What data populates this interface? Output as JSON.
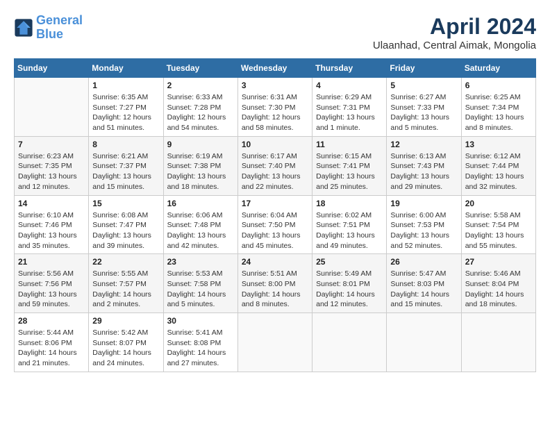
{
  "logo": {
    "line1": "General",
    "line2": "Blue"
  },
  "title": "April 2024",
  "location": "Ulaanhad, Central Aimak, Mongolia",
  "weekdays": [
    "Sunday",
    "Monday",
    "Tuesday",
    "Wednesday",
    "Thursday",
    "Friday",
    "Saturday"
  ],
  "weeks": [
    [
      {
        "day": "",
        "detail": ""
      },
      {
        "day": "1",
        "detail": "Sunrise: 6:35 AM\nSunset: 7:27 PM\nDaylight: 12 hours\nand 51 minutes."
      },
      {
        "day": "2",
        "detail": "Sunrise: 6:33 AM\nSunset: 7:28 PM\nDaylight: 12 hours\nand 54 minutes."
      },
      {
        "day": "3",
        "detail": "Sunrise: 6:31 AM\nSunset: 7:30 PM\nDaylight: 12 hours\nand 58 minutes."
      },
      {
        "day": "4",
        "detail": "Sunrise: 6:29 AM\nSunset: 7:31 PM\nDaylight: 13 hours\nand 1 minute."
      },
      {
        "day": "5",
        "detail": "Sunrise: 6:27 AM\nSunset: 7:33 PM\nDaylight: 13 hours\nand 5 minutes."
      },
      {
        "day": "6",
        "detail": "Sunrise: 6:25 AM\nSunset: 7:34 PM\nDaylight: 13 hours\nand 8 minutes."
      }
    ],
    [
      {
        "day": "7",
        "detail": "Sunrise: 6:23 AM\nSunset: 7:35 PM\nDaylight: 13 hours\nand 12 minutes."
      },
      {
        "day": "8",
        "detail": "Sunrise: 6:21 AM\nSunset: 7:37 PM\nDaylight: 13 hours\nand 15 minutes."
      },
      {
        "day": "9",
        "detail": "Sunrise: 6:19 AM\nSunset: 7:38 PM\nDaylight: 13 hours\nand 18 minutes."
      },
      {
        "day": "10",
        "detail": "Sunrise: 6:17 AM\nSunset: 7:40 PM\nDaylight: 13 hours\nand 22 minutes."
      },
      {
        "day": "11",
        "detail": "Sunrise: 6:15 AM\nSunset: 7:41 PM\nDaylight: 13 hours\nand 25 minutes."
      },
      {
        "day": "12",
        "detail": "Sunrise: 6:13 AM\nSunset: 7:43 PM\nDaylight: 13 hours\nand 29 minutes."
      },
      {
        "day": "13",
        "detail": "Sunrise: 6:12 AM\nSunset: 7:44 PM\nDaylight: 13 hours\nand 32 minutes."
      }
    ],
    [
      {
        "day": "14",
        "detail": "Sunrise: 6:10 AM\nSunset: 7:46 PM\nDaylight: 13 hours\nand 35 minutes."
      },
      {
        "day": "15",
        "detail": "Sunrise: 6:08 AM\nSunset: 7:47 PM\nDaylight: 13 hours\nand 39 minutes."
      },
      {
        "day": "16",
        "detail": "Sunrise: 6:06 AM\nSunset: 7:48 PM\nDaylight: 13 hours\nand 42 minutes."
      },
      {
        "day": "17",
        "detail": "Sunrise: 6:04 AM\nSunset: 7:50 PM\nDaylight: 13 hours\nand 45 minutes."
      },
      {
        "day": "18",
        "detail": "Sunrise: 6:02 AM\nSunset: 7:51 PM\nDaylight: 13 hours\nand 49 minutes."
      },
      {
        "day": "19",
        "detail": "Sunrise: 6:00 AM\nSunset: 7:53 PM\nDaylight: 13 hours\nand 52 minutes."
      },
      {
        "day": "20",
        "detail": "Sunrise: 5:58 AM\nSunset: 7:54 PM\nDaylight: 13 hours\nand 55 minutes."
      }
    ],
    [
      {
        "day": "21",
        "detail": "Sunrise: 5:56 AM\nSunset: 7:56 PM\nDaylight: 13 hours\nand 59 minutes."
      },
      {
        "day": "22",
        "detail": "Sunrise: 5:55 AM\nSunset: 7:57 PM\nDaylight: 14 hours\nand 2 minutes."
      },
      {
        "day": "23",
        "detail": "Sunrise: 5:53 AM\nSunset: 7:58 PM\nDaylight: 14 hours\nand 5 minutes."
      },
      {
        "day": "24",
        "detail": "Sunrise: 5:51 AM\nSunset: 8:00 PM\nDaylight: 14 hours\nand 8 minutes."
      },
      {
        "day": "25",
        "detail": "Sunrise: 5:49 AM\nSunset: 8:01 PM\nDaylight: 14 hours\nand 12 minutes."
      },
      {
        "day": "26",
        "detail": "Sunrise: 5:47 AM\nSunset: 8:03 PM\nDaylight: 14 hours\nand 15 minutes."
      },
      {
        "day": "27",
        "detail": "Sunrise: 5:46 AM\nSunset: 8:04 PM\nDaylight: 14 hours\nand 18 minutes."
      }
    ],
    [
      {
        "day": "28",
        "detail": "Sunrise: 5:44 AM\nSunset: 8:06 PM\nDaylight: 14 hours\nand 21 minutes."
      },
      {
        "day": "29",
        "detail": "Sunrise: 5:42 AM\nSunset: 8:07 PM\nDaylight: 14 hours\nand 24 minutes."
      },
      {
        "day": "30",
        "detail": "Sunrise: 5:41 AM\nSunset: 8:08 PM\nDaylight: 14 hours\nand 27 minutes."
      },
      {
        "day": "",
        "detail": ""
      },
      {
        "day": "",
        "detail": ""
      },
      {
        "day": "",
        "detail": ""
      },
      {
        "day": "",
        "detail": ""
      }
    ]
  ]
}
